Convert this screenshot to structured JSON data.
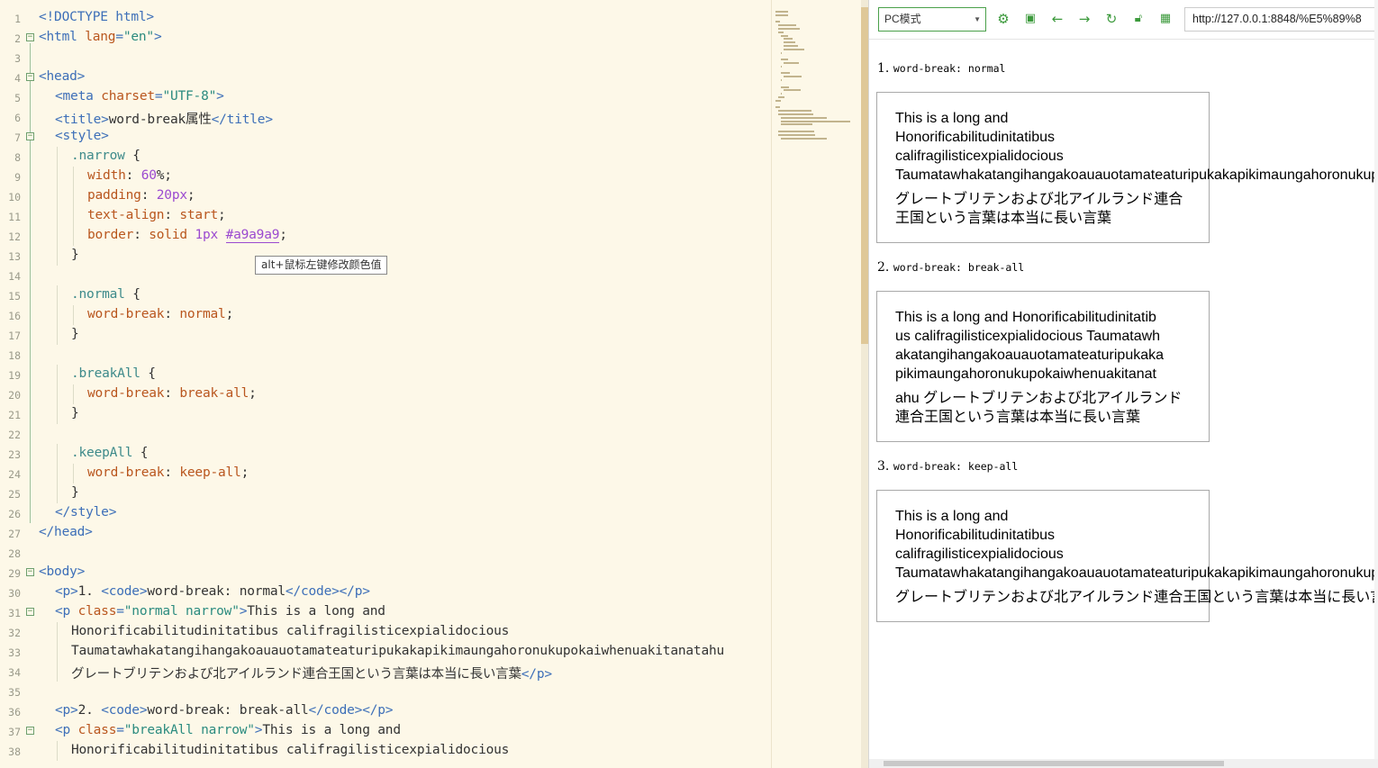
{
  "editor": {
    "lines": [
      {
        "n": "1",
        "fold": false,
        "indent": 0,
        "parts": [
          [
            "t",
            "<!DOCTYPE html>"
          ]
        ]
      },
      {
        "n": "2",
        "fold": true,
        "indent": 0,
        "parts": [
          [
            "t",
            "<html "
          ],
          [
            "a",
            "lang"
          ],
          [
            "t",
            "="
          ],
          [
            "s",
            "\"en\""
          ],
          [
            "t",
            ">"
          ]
        ]
      },
      {
        "n": "3",
        "fold": false,
        "indent": 0,
        "parts": []
      },
      {
        "n": "4",
        "fold": true,
        "indent": 0,
        "parts": [
          [
            "t",
            "<head>"
          ]
        ]
      },
      {
        "n": "5",
        "fold": false,
        "indent": 1,
        "parts": [
          [
            "t",
            "<meta "
          ],
          [
            "a",
            "charset"
          ],
          [
            "t",
            "="
          ],
          [
            "s",
            "\"UTF-8\""
          ],
          [
            "t",
            ">"
          ]
        ]
      },
      {
        "n": "6",
        "fold": false,
        "indent": 1,
        "parts": [
          [
            "t",
            "<title>"
          ],
          [
            "x",
            "word-break属性"
          ],
          [
            "t",
            "</title>"
          ]
        ]
      },
      {
        "n": "7",
        "fold": true,
        "indent": 1,
        "parts": [
          [
            "t",
            "<style>"
          ]
        ]
      },
      {
        "n": "8",
        "fold": false,
        "indent": 2,
        "parts": [
          [
            "sel",
            ".narrow"
          ],
          [
            "x",
            " {"
          ]
        ]
      },
      {
        "n": "9",
        "fold": false,
        "indent": 3,
        "parts": [
          [
            "p",
            "width"
          ],
          [
            "x",
            ": "
          ],
          [
            "v",
            "60"
          ],
          [
            "x",
            "%;"
          ]
        ]
      },
      {
        "n": "10",
        "fold": false,
        "indent": 3,
        "parts": [
          [
            "p",
            "padding"
          ],
          [
            "x",
            ": "
          ],
          [
            "v",
            "20px"
          ],
          [
            "x",
            ";"
          ]
        ]
      },
      {
        "n": "11",
        "fold": false,
        "indent": 3,
        "parts": [
          [
            "p",
            "text-align"
          ],
          [
            "x",
            ": "
          ],
          [
            "p",
            "start"
          ],
          [
            "x",
            ";"
          ]
        ]
      },
      {
        "n": "12",
        "fold": false,
        "indent": 3,
        "parts": [
          [
            "p",
            "border"
          ],
          [
            "x",
            ": "
          ],
          [
            "p",
            "solid "
          ],
          [
            "v",
            "1px "
          ],
          [
            "v",
            "#a9a9a9"
          ],
          [
            "x",
            ";"
          ]
        ]
      },
      {
        "n": "13",
        "fold": false,
        "indent": 2,
        "parts": [
          [
            "x",
            "}"
          ]
        ]
      },
      {
        "n": "14",
        "fold": false,
        "indent": 0,
        "parts": []
      },
      {
        "n": "15",
        "fold": false,
        "indent": 2,
        "parts": [
          [
            "sel",
            ".normal"
          ],
          [
            "x",
            " {"
          ]
        ]
      },
      {
        "n": "16",
        "fold": false,
        "indent": 3,
        "parts": [
          [
            "p",
            "word-break"
          ],
          [
            "x",
            ": "
          ],
          [
            "p",
            "normal"
          ],
          [
            "x",
            ";"
          ]
        ]
      },
      {
        "n": "17",
        "fold": false,
        "indent": 2,
        "parts": [
          [
            "x",
            "}"
          ]
        ]
      },
      {
        "n": "18",
        "fold": false,
        "indent": 0,
        "parts": []
      },
      {
        "n": "19",
        "fold": false,
        "indent": 2,
        "parts": [
          [
            "sel",
            ".breakAll"
          ],
          [
            "x",
            " {"
          ]
        ]
      },
      {
        "n": "20",
        "fold": false,
        "indent": 3,
        "parts": [
          [
            "p",
            "word-break"
          ],
          [
            "x",
            ": "
          ],
          [
            "p",
            "break-all"
          ],
          [
            "x",
            ";"
          ]
        ]
      },
      {
        "n": "21",
        "fold": false,
        "indent": 2,
        "parts": [
          [
            "x",
            "}"
          ]
        ]
      },
      {
        "n": "22",
        "fold": false,
        "indent": 0,
        "parts": []
      },
      {
        "n": "23",
        "fold": false,
        "indent": 2,
        "parts": [
          [
            "sel",
            ".keepAll"
          ],
          [
            "x",
            " {"
          ]
        ]
      },
      {
        "n": "24",
        "fold": false,
        "indent": 3,
        "parts": [
          [
            "p",
            "word-break"
          ],
          [
            "x",
            ": "
          ],
          [
            "p",
            "keep-all"
          ],
          [
            "x",
            ";"
          ]
        ]
      },
      {
        "n": "25",
        "fold": false,
        "indent": 2,
        "parts": [
          [
            "x",
            "}"
          ]
        ]
      },
      {
        "n": "26",
        "fold": false,
        "indent": 1,
        "parts": [
          [
            "t",
            "</style>"
          ]
        ]
      },
      {
        "n": "27",
        "fold": false,
        "indent": 0,
        "parts": [
          [
            "t",
            "</head>"
          ]
        ]
      },
      {
        "n": "28",
        "fold": false,
        "indent": 0,
        "parts": []
      },
      {
        "n": "29",
        "fold": true,
        "indent": 0,
        "parts": [
          [
            "t",
            "<body>"
          ]
        ]
      },
      {
        "n": "30",
        "fold": false,
        "indent": 1,
        "parts": [
          [
            "t",
            "<p>"
          ],
          [
            "x",
            "1. "
          ],
          [
            "t",
            "<code>"
          ],
          [
            "x",
            "word-break: normal"
          ],
          [
            "t",
            "</code></p>"
          ]
        ]
      },
      {
        "n": "31",
        "fold": true,
        "indent": 1,
        "parts": [
          [
            "t",
            "<p "
          ],
          [
            "a",
            "class"
          ],
          [
            "t",
            "="
          ],
          [
            "s",
            "\"normal narrow\""
          ],
          [
            "t",
            ">"
          ],
          [
            "x",
            "This is a long and"
          ]
        ]
      },
      {
        "n": "32",
        "fold": false,
        "indent": 2,
        "parts": [
          [
            "x",
            "Honorificabilitudinitatibus califragilisticexpialidocious"
          ]
        ]
      },
      {
        "n": "33",
        "fold": false,
        "indent": 2,
        "parts": [
          [
            "x",
            "Taumatawhakatangihangakoauauotamateaturipukakapikimaungahoronukupokaiwhenuakitanatahu"
          ]
        ]
      },
      {
        "n": "34",
        "fold": false,
        "indent": 2,
        "parts": [
          [
            "x",
            "グレートブリテンおよび北アイルランド連合王国という言葉は本当に長い言葉"
          ],
          [
            "t",
            "</p>"
          ]
        ]
      },
      {
        "n": "35",
        "fold": false,
        "indent": 0,
        "parts": []
      },
      {
        "n": "36",
        "fold": false,
        "indent": 1,
        "parts": [
          [
            "t",
            "<p>"
          ],
          [
            "x",
            "2. "
          ],
          [
            "t",
            "<code>"
          ],
          [
            "x",
            "word-break: break-all"
          ],
          [
            "t",
            "</code></p>"
          ]
        ]
      },
      {
        "n": "37",
        "fold": true,
        "indent": 1,
        "parts": [
          [
            "t",
            "<p "
          ],
          [
            "a",
            "class"
          ],
          [
            "t",
            "="
          ],
          [
            "s",
            "\"breakAll narrow\""
          ],
          [
            "t",
            ">"
          ],
          [
            "x",
            "This is a long and"
          ]
        ]
      },
      {
        "n": "38",
        "fold": false,
        "indent": 2,
        "parts": [
          [
            "x",
            "Honorificabilitudinitatibus califragilisticexpialidocious"
          ]
        ]
      }
    ],
    "tooltip": "alt+鼠标左键修改颜色值"
  },
  "browser": {
    "mode": "PC模式",
    "url": "http://127.0.0.1:8848/%E5%89%8",
    "icons": [
      "settings-icon",
      "terminal-icon",
      "back-arrow-icon",
      "forward-arrow-icon",
      "refresh-icon",
      "lock-icon",
      "qr-code-icon"
    ],
    "sections": [
      {
        "num": "1.",
        "code": "word-break: normal",
        "lines": [
          "This is a long and",
          "Honorificabilitudinitatibus",
          "califragilisticexpialidocious",
          "Taumatawhakatangihangakoauauotamateaturipukakapikimaungahoronukupokaiwhenuakitanatahu",
          "グレートブリテンおよび北アイルランド連合",
          "王国という言葉は本当に長い言葉"
        ]
      },
      {
        "num": "2.",
        "code": "word-break: break-all",
        "lines": [
          "This is a long and Honorificabilitudinitatib",
          "us califragilisticexpialidocious Taumatawh",
          "akatangihangakoauauotamateaturipukaka",
          "pikimaungahoronukupokaiwhenuakitanat",
          "ahu グレートブリテンおよび北アイルランド",
          "連合王国という言葉は本当に長い言葉"
        ]
      },
      {
        "num": "3.",
        "code": "word-break: keep-all",
        "lines": [
          "This is a long and",
          "Honorificabilitudinitatibus",
          "califragilisticexpialidocious",
          "Taumatawhakatangihangakoauauotamateaturipukakapikimaungahoronukupokaiwhenuakitanatahu",
          "グレートブリテンおよび北アイルランド連合王国という言葉は本当に長い言葉"
        ]
      }
    ]
  }
}
